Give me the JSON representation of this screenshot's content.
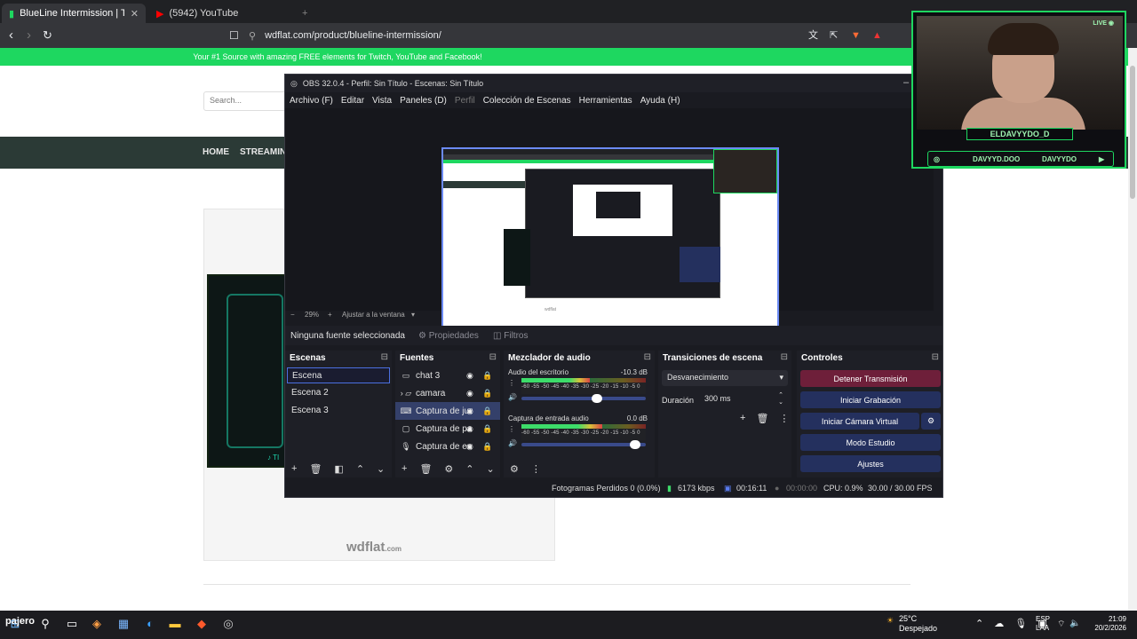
{
  "browser": {
    "tabs": [
      {
        "title": "BlueLine Intermission | Twitch an",
        "close": "✕"
      },
      {
        "title": "(5942) YouTube"
      }
    ],
    "new_tab": "+",
    "url": "wdflat.com/product/blueline-intermission/"
  },
  "site": {
    "banner": "Your #1 Source with amazing FREE elements for Twitch, YouTube and Facebook!",
    "search_placeholder": "Search...",
    "nav": [
      "HOME",
      "STREAMING"
    ],
    "brand": "wdflat",
    "brand_suffix": ".com",
    "tt_badge": "♪ TI"
  },
  "obs": {
    "title": "OBS 32.0.4 - Perfil: Sin Título - Escenas: Sin Título",
    "menu": [
      "Archivo (F)",
      "Editar",
      "Vista",
      "Paneles (D)",
      "Perfil",
      "Colección de Escenas",
      "Herramientas",
      "Ayuda (H)"
    ],
    "zoom": {
      "minus": "−",
      "value": "29%",
      "plus": "+",
      "fit": "Ajustar a la ventana"
    },
    "source_bar": {
      "none": "Ninguna fuente seleccionada",
      "properties": "Propiedades",
      "filters": "Filtros"
    },
    "scenes": {
      "header": "Escenas",
      "items": [
        "Escena",
        "Escena 2",
        "Escena 3"
      ],
      "selected": 0
    },
    "sources": {
      "header": "Fuentes",
      "items": [
        {
          "name": "chat 3",
          "icon": "window-icon"
        },
        {
          "name": "camara",
          "icon": "folder-icon"
        },
        {
          "name": "Captura de juego",
          "icon": "gamepad-icon"
        },
        {
          "name": "Captura de pantalla",
          "icon": "monitor-icon"
        },
        {
          "name": "Captura de entrada de audio",
          "icon": "mic-icon"
        }
      ],
      "selected": 2
    },
    "mixer": {
      "header": "Mezclador de audio",
      "channels": [
        {
          "name": "Audio del escritorio",
          "db": "-10.3 dB",
          "level": 0.55,
          "volume": 0.62
        },
        {
          "name": "Captura de entrada audio",
          "db": "0.0 dB",
          "level": 0.65,
          "volume": 0.95
        }
      ],
      "scale": "-60 -55 -50 -45 -40 -35 -30 -25 -20 -15 -10 -5 0"
    },
    "transitions": {
      "header": "Transiciones de escena",
      "type": "Desvanecimiento",
      "duration_label": "Duración",
      "duration": "300 ms"
    },
    "controls": {
      "header": "Controles",
      "buttons": [
        "Detener Transmisión",
        "Iniciar Grabación",
        "Iniciar Cámara Virtual",
        "Modo Estudio",
        "Ajustes"
      ]
    },
    "status": {
      "dropped": "Fotogramas Perdidos 0 (0.0%)",
      "bitrate": "6173 kbps",
      "stream_time": "00:16:11",
      "rec_time": "00:00:00",
      "cpu": "CPU: 0.9%",
      "fps": "30.00 / 30.00 FPS"
    }
  },
  "webcam": {
    "live": "LIVE ◉",
    "name": "ELDAVYYDO_D",
    "handle1": "DAVYYD.DOO",
    "handle2": "DAVYYDO"
  },
  "taskbar": {
    "weather_temp": "25°C",
    "weather_desc": "Despejado",
    "lang1": "ESP",
    "lang2": "LAA",
    "time": "21:09",
    "date": "20/2/2026",
    "search_text": "pajero"
  }
}
